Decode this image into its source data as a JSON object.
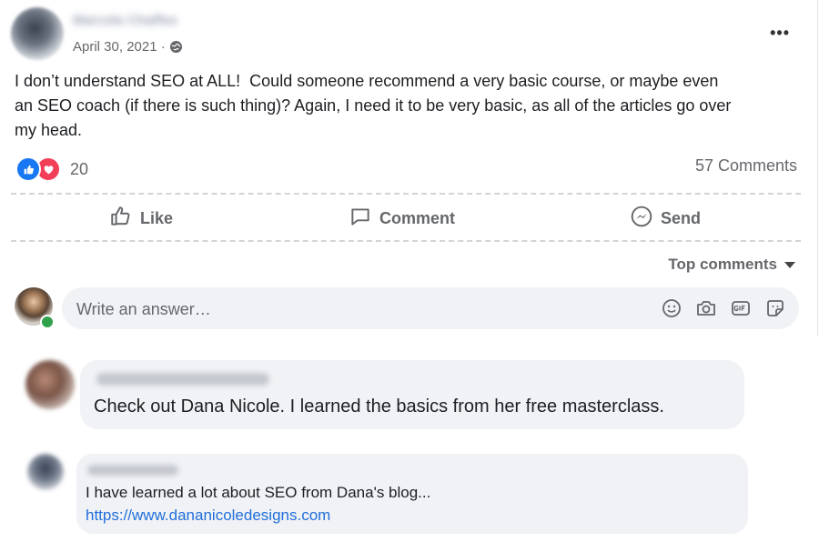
{
  "post": {
    "author_name": "Marcela Chaffee",
    "date": "April 30, 2021 ·",
    "privacy_icon": "globe-icon",
    "more_label": "•••",
    "text": "I don’t understand SEO at ALL!  Could someone recommend a very basic course, or maybe even\nan SEO coach (if there is such thing)? Again, I need it to be very basic, as all of the articles go over\nmy head.",
    "reaction_icons": [
      "like-icon",
      "love-icon"
    ],
    "reaction_count": "20",
    "comments_count": "57 Comments"
  },
  "actions": {
    "like_label": "Like",
    "comment_label": "Comment",
    "send_label": "Send"
  },
  "comments_section": {
    "sort_label": "Top comments",
    "write_placeholder": "Write an answer…",
    "input_icons": [
      "emoji-icon",
      "camera-icon",
      "gif-icon",
      "sticker-icon"
    ]
  },
  "comments": [
    {
      "author": "Bo Kristin Legend",
      "text": "Check out Dana Nicole. I learned the basics from her free masterclass."
    },
    {
      "author": "Jane Clifford",
      "text": "I have learned a lot about SEO from Dana's blog...",
      "link": "https://www.dananicoledesigns.com"
    }
  ],
  "colors": {
    "brand_blue": "#1877f2",
    "love_red": "#f33e58",
    "link_blue": "#216fdb",
    "online_green": "#31a24c"
  }
}
